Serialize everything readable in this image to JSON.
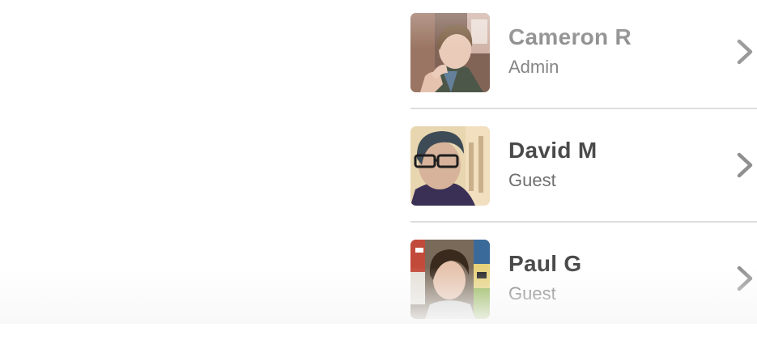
{
  "users": [
    {
      "name": "Cameron R",
      "role": "Admin",
      "avatar_icon": "person-photo-icon",
      "chevron_icon": "chevron-right-icon"
    },
    {
      "name": "David M",
      "role": "Guest",
      "avatar_icon": "person-photo-icon",
      "chevron_icon": "chevron-right-icon"
    },
    {
      "name": "Paul G",
      "role": "Guest",
      "avatar_icon": "person-photo-icon",
      "chevron_icon": "chevron-right-icon"
    }
  ],
  "colors": {
    "name_text": "#4a4a4a",
    "role_text": "#6f6f6f",
    "chevron": "#9a9a9a",
    "divider": "#dedede"
  }
}
